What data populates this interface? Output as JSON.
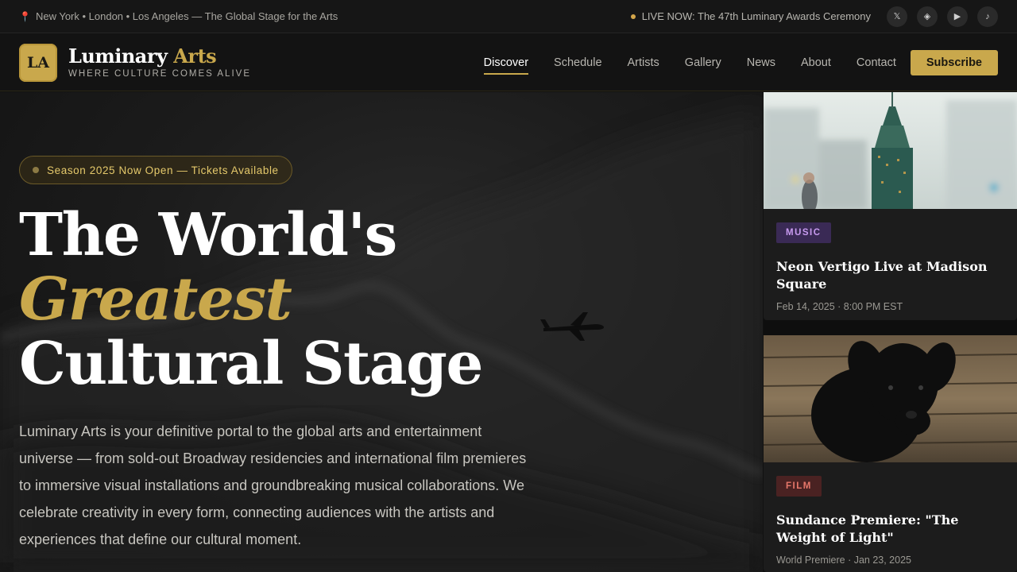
{
  "topbar": {
    "locations": "New York • London • Los Angeles — The Global Stage for the Arts",
    "pin_icon": "map-pin-icon",
    "live_text": "LIVE NOW: The 47th Luminary Awards Ceremony",
    "social": [
      {
        "icon": "x-icon",
        "glyph": "𝕏"
      },
      {
        "icon": "instagram-icon",
        "glyph": "◈"
      },
      {
        "icon": "youtube-icon",
        "glyph": "▶"
      },
      {
        "icon": "tiktok-icon",
        "glyph": "♪"
      }
    ]
  },
  "header": {
    "logo_mark": "LA",
    "brand_main": "Luminary",
    "brand_accent": "Arts",
    "tagline": "WHERE CULTURE COMES ALIVE",
    "nav": [
      {
        "label": "Discover",
        "active": true
      },
      {
        "label": "Schedule",
        "active": false
      },
      {
        "label": "Artists",
        "active": false
      },
      {
        "label": "Gallery",
        "active": false
      },
      {
        "label": "News",
        "active": false
      },
      {
        "label": "About",
        "active": false
      },
      {
        "label": "Contact",
        "active": false
      }
    ],
    "subscribe_label": "Subscribe"
  },
  "hero": {
    "badge": "Season 2025 Now Open — Tickets Available",
    "headline_line1": "The World's",
    "headline_line2": "Greatest",
    "headline_line3": "Cultural Stage",
    "lead": "Luminary Arts is your definitive portal to the global arts and entertainment universe — from sold-out Broadway residencies and international film premieres to immersive visual installations and groundbreaking musical collaborations. We celebrate creativity in every form, connecting audiences with the artists and experiences that define our cultural moment."
  },
  "cards": [
    {
      "tag": "MUSIC",
      "title": "Neon Vertigo Live at Madison Square",
      "meta": "Feb 14, 2025 · 8:00 PM EST"
    },
    {
      "tag": "FILM",
      "title": "Sundance Premiere: \"The Weight of Light\"",
      "meta": "World Premiere · Jan 23, 2025"
    }
  ],
  "colors": {
    "accent": "#c9a84c",
    "music_tag": "#c89bf0",
    "film_tag": "#e7776a"
  }
}
